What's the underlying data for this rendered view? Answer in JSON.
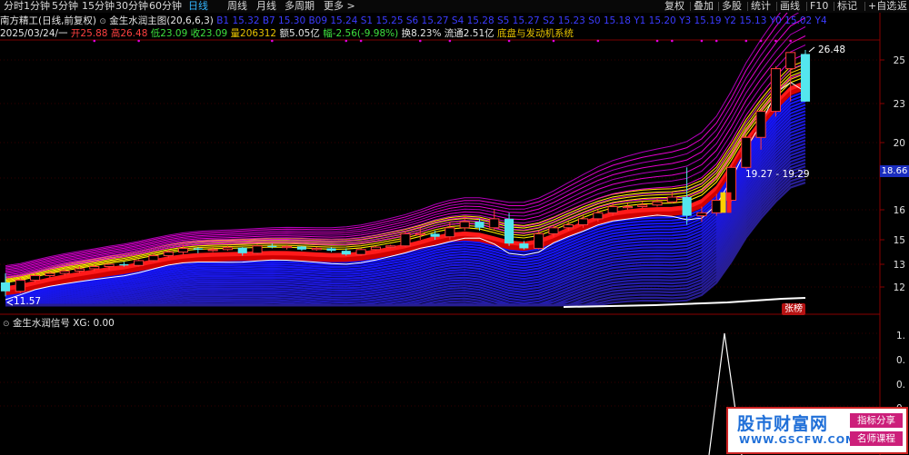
{
  "toolbar": {
    "left": [
      "分时",
      "1分钟",
      "5分钟",
      "15分钟",
      "30分钟",
      "60分钟",
      "日线",
      "周线",
      "月线",
      "多周期",
      "更多 >"
    ],
    "active": "日线",
    "right": [
      "复权",
      "叠加",
      "多股",
      "统计",
      "画线",
      "F10",
      "标记",
      "+自选",
      "返"
    ]
  },
  "chart_header": {
    "stock_title": "南方精工(日线,前复权)",
    "indicator": "金生水润主图(20,6,6,3)",
    "signal_text": "B1 15.32 B7 15.30 B09 15.24 S1 15.25 S6 15.27 S4 15.28 S5 15.27 S2 15.23 S0 15.18 Y1 15.20 Y3 15.19 Y2 15.13 Y0 15.02 Y4"
  },
  "ohlc": {
    "date": "2025/03/24/一",
    "open_label": "开",
    "open": "25.88",
    "high_label": "高",
    "high": "26.48",
    "low_label": "低",
    "low": "23.09",
    "close_label": "收",
    "close": "23.09",
    "volume_label": "量",
    "volume": "206312",
    "amount_label": "额",
    "amount": "5.05亿",
    "change_label": "幅",
    "change": "-2.56(-9.98%)",
    "turnover_label": "换",
    "turnover": "8.23%",
    "float_label": "流通",
    "float": "2.51亿",
    "system_name": "底盘与发动机系统"
  },
  "annotations": {
    "high_mark": "26.48",
    "low_mark": "11.57",
    "range_label": "19.27 - 19.29",
    "current_price_tag": "18.66",
    "limit_badge": "张榜"
  },
  "sub_indicator": {
    "name": "金生水润信号",
    "value_text": "XG: 0.00",
    "axis": [
      "1.",
      "0.",
      "0.",
      "0."
    ]
  },
  "watermark": {
    "title": "股市财富网",
    "url": "WWW.GSCFW.COM",
    "tag1": "指标分享",
    "tag2": "名师课程"
  },
  "colors": {
    "up": "#ff3b3b",
    "down": "#54e6ee",
    "ma_white": "#ffffff",
    "band_yellow": "#ffee00",
    "band_red": "#ff1a1a",
    "band_magenta": "#e600d0",
    "band_blue": "#1a1aff",
    "grid": "#6a0000",
    "active_tab": "#33b6ff"
  },
  "chart_data": {
    "type": "candlestick",
    "ylim": [
      11,
      26.48
    ],
    "yticks": [
      25,
      23,
      20,
      18,
      16,
      15,
      13,
      12
    ],
    "candles": [
      {
        "o": 12.2,
        "h": 12.6,
        "l": 11.57,
        "c": 11.8
      },
      {
        "o": 11.8,
        "h": 12.4,
        "l": 11.7,
        "c": 12.3
      },
      {
        "o": 12.3,
        "h": 12.6,
        "l": 12.2,
        "c": 12.5
      },
      {
        "o": 12.5,
        "h": 12.7,
        "l": 12.4,
        "c": 12.6
      },
      {
        "o": 12.6,
        "h": 12.8,
        "l": 12.5,
        "c": 12.7
      },
      {
        "o": 12.7,
        "h": 12.9,
        "l": 12.6,
        "c": 12.8
      },
      {
        "o": 12.8,
        "h": 13.0,
        "l": 12.7,
        "c": 12.9
      },
      {
        "o": 12.9,
        "h": 13.1,
        "l": 12.75,
        "c": 13.0
      },
      {
        "o": 13.0,
        "h": 13.2,
        "l": 12.9,
        "c": 12.95
      },
      {
        "o": 12.95,
        "h": 13.4,
        "l": 12.9,
        "c": 13.3
      },
      {
        "o": 13.3,
        "h": 13.9,
        "l": 13.2,
        "c": 13.7
      },
      {
        "o": 13.7,
        "h": 14.2,
        "l": 13.5,
        "c": 14.0
      },
      {
        "o": 14.0,
        "h": 14.6,
        "l": 13.8,
        "c": 14.3
      },
      {
        "o": 14.3,
        "h": 14.4,
        "l": 13.9,
        "c": 14.2
      },
      {
        "o": 14.2,
        "h": 14.4,
        "l": 14.0,
        "c": 14.2
      },
      {
        "o": 14.2,
        "h": 14.5,
        "l": 14.1,
        "c": 14.35
      },
      {
        "o": 14.35,
        "h": 14.4,
        "l": 13.7,
        "c": 13.9
      },
      {
        "o": 13.9,
        "h": 14.6,
        "l": 13.8,
        "c": 14.5
      },
      {
        "o": 14.5,
        "h": 14.7,
        "l": 14.3,
        "c": 14.4
      },
      {
        "o": 14.4,
        "h": 14.6,
        "l": 14.2,
        "c": 14.45
      },
      {
        "o": 14.45,
        "h": 14.5,
        "l": 14.1,
        "c": 14.2
      },
      {
        "o": 14.2,
        "h": 14.4,
        "l": 14.1,
        "c": 14.3
      },
      {
        "o": 14.3,
        "h": 14.4,
        "l": 14.0,
        "c": 14.1
      },
      {
        "o": 14.1,
        "h": 14.3,
        "l": 13.7,
        "c": 13.8
      },
      {
        "o": 13.8,
        "h": 14.3,
        "l": 13.7,
        "c": 14.2
      },
      {
        "o": 14.2,
        "h": 14.5,
        "l": 14.1,
        "c": 14.4
      },
      {
        "o": 14.4,
        "h": 14.6,
        "l": 14.3,
        "c": 14.5
      },
      {
        "o": 14.5,
        "h": 15.3,
        "l": 14.4,
        "c": 15.2
      },
      {
        "o": 15.2,
        "h": 15.4,
        "l": 15.0,
        "c": 15.2
      },
      {
        "o": 15.2,
        "h": 15.3,
        "l": 15.0,
        "c": 15.1
      },
      {
        "o": 15.1,
        "h": 15.6,
        "l": 15.0,
        "c": 15.4
      },
      {
        "o": 15.4,
        "h": 15.8,
        "l": 15.3,
        "c": 15.6
      },
      {
        "o": 15.6,
        "h": 15.7,
        "l": 15.3,
        "c": 15.4
      },
      {
        "o": 15.4,
        "h": 16.0,
        "l": 15.3,
        "c": 15.7
      },
      {
        "o": 15.7,
        "h": 15.9,
        "l": 14.5,
        "c": 14.7
      },
      {
        "o": 14.7,
        "h": 14.9,
        "l": 14.2,
        "c": 14.3
      },
      {
        "o": 14.3,
        "h": 15.3,
        "l": 14.2,
        "c": 15.2
      },
      {
        "o": 15.2,
        "h": 15.5,
        "l": 15.1,
        "c": 15.4
      },
      {
        "o": 15.4,
        "h": 15.6,
        "l": 15.3,
        "c": 15.5
      },
      {
        "o": 15.5,
        "h": 15.8,
        "l": 15.4,
        "c": 15.7
      },
      {
        "o": 15.7,
        "h": 16.0,
        "l": 15.6,
        "c": 15.9
      },
      {
        "o": 15.9,
        "h": 16.4,
        "l": 15.8,
        "c": 16.2
      },
      {
        "o": 16.2,
        "h": 16.4,
        "l": 16.0,
        "c": 16.2
      },
      {
        "o": 16.2,
        "h": 16.5,
        "l": 16.1,
        "c": 16.3
      },
      {
        "o": 16.3,
        "h": 16.7,
        "l": 16.2,
        "c": 16.5
      },
      {
        "o": 16.5,
        "h": 17.1,
        "l": 16.4,
        "c": 16.8
      },
      {
        "o": 16.8,
        "h": 18.6,
        "l": 15.5,
        "c": 15.8
      },
      {
        "o": 15.8,
        "h": 16.2,
        "l": 15.6,
        "c": 15.9
      },
      {
        "o": 15.9,
        "h": 17.0,
        "l": 15.8,
        "c": 16.6
      },
      {
        "o": 16.6,
        "h": 18.7,
        "l": 16.5,
        "c": 18.6
      },
      {
        "o": 18.6,
        "h": 20.5,
        "l": 18.5,
        "c": 20.4
      },
      {
        "o": 20.4,
        "h": 22.5,
        "l": 19.6,
        "c": 22.4
      },
      {
        "o": 22.4,
        "h": 24.7,
        "l": 22.0,
        "c": 24.6
      },
      {
        "o": 24.6,
        "h": 26.2,
        "l": 23.1,
        "c": 26.1
      },
      {
        "o": 25.88,
        "h": 26.48,
        "l": 23.09,
        "c": 23.09
      }
    ]
  }
}
